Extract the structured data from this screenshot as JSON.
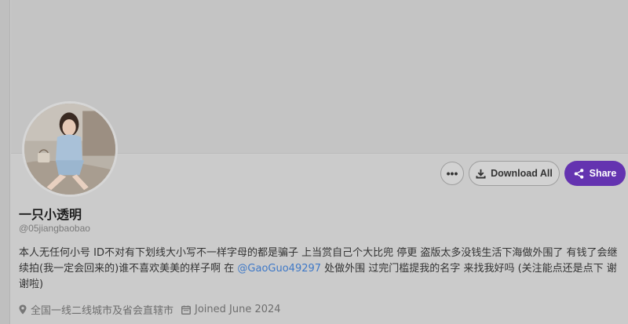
{
  "profile": {
    "display_name": "一只小透明",
    "handle": "@05jiangbaobao",
    "bio_part1": "本人无任何小号 ID不对有下划线大小写不一样字母的都是骗子 上当赏自己个大比兜 停更 盗版太多没钱生活下海做外围了 有钱了会继续拍(我一定会回来的)谁不喜欢美美的样子啊 在 ",
    "bio_mention": "@GaoGuo49297",
    "bio_part2": " 处做外围 过完门槛提我的名字 来找我好吗 (关注能点还是点下 谢谢啦)",
    "location": "全国一线二线城市及省会直辖市",
    "joined": "Joined June 2024"
  },
  "actions": {
    "more_label": "•••",
    "download_label": "Download All",
    "share_label": "Share"
  },
  "icons": {
    "more": "more-options-icon",
    "download": "download-icon",
    "share": "share-icon",
    "location": "map-pin-icon",
    "calendar": "calendar-icon"
  },
  "colors": {
    "share_button": "#6433b0",
    "mention": "#3f79c7",
    "background": "#cccccc"
  }
}
